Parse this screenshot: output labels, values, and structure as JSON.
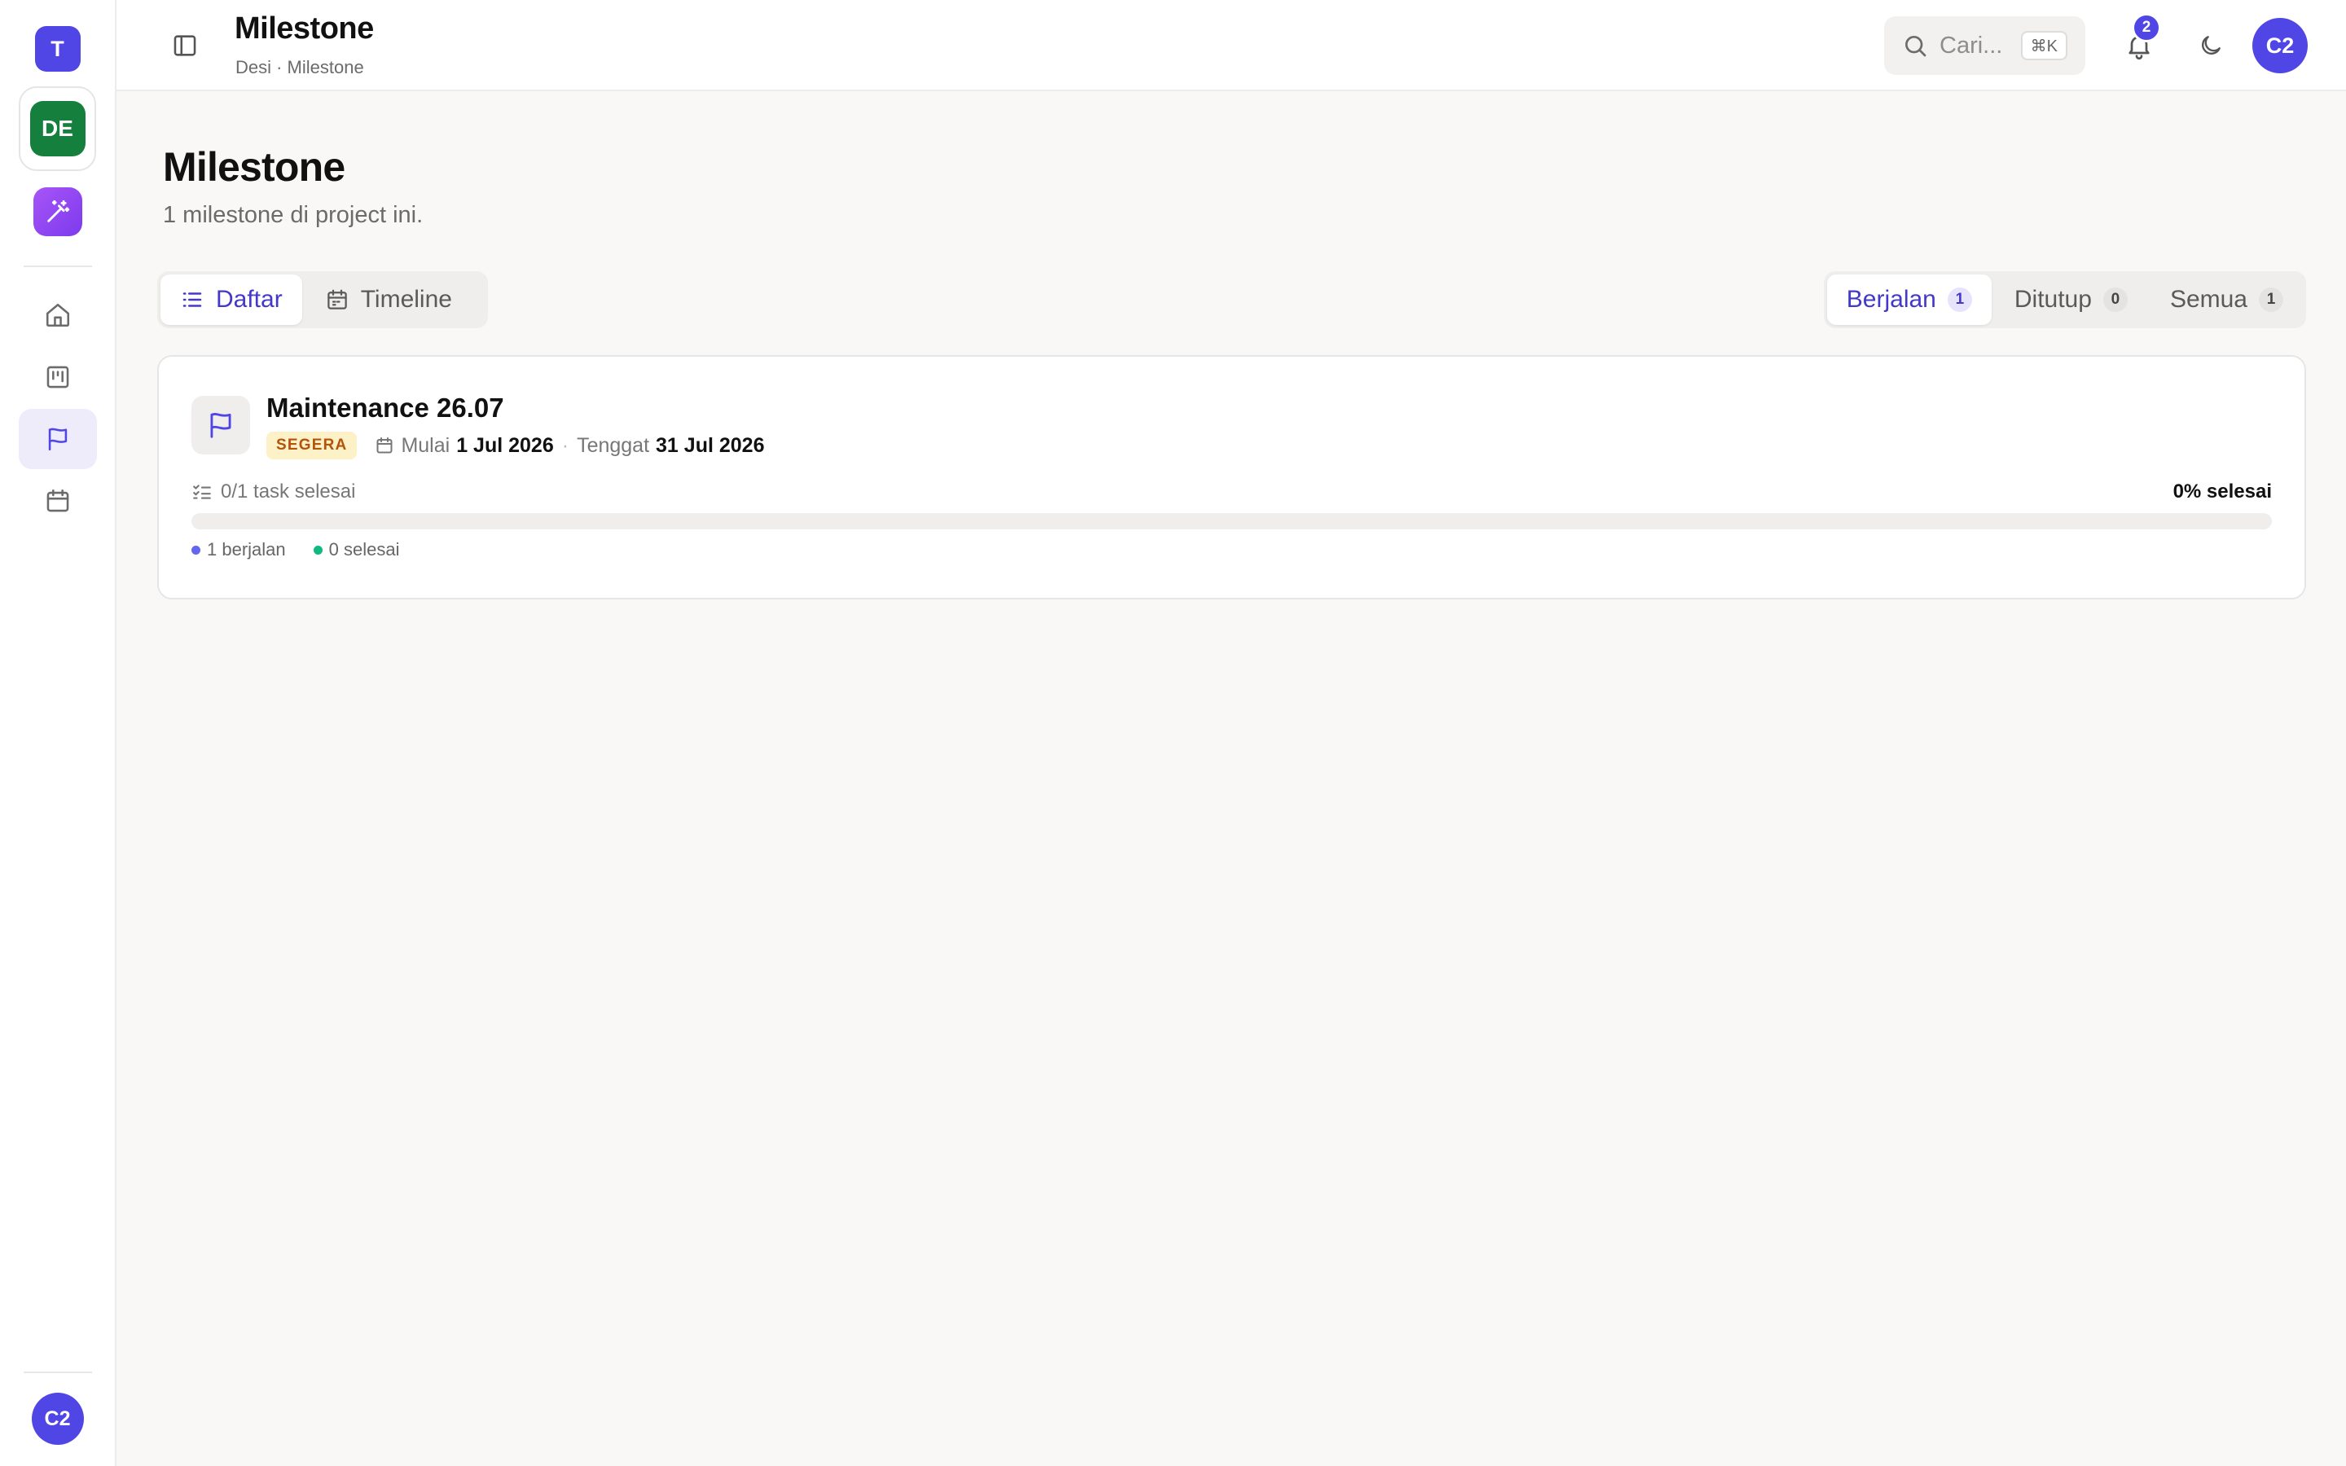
{
  "rail": {
    "workspace_initial": "T",
    "project_initials": "DE",
    "user_initials": "C2",
    "items": [
      {
        "name": "home",
        "icon": "home-icon",
        "active": false
      },
      {
        "name": "board",
        "icon": "board-icon",
        "active": false
      },
      {
        "name": "milestone",
        "icon": "flag-icon",
        "active": true
      },
      {
        "name": "calendar",
        "icon": "calendar-icon",
        "active": false
      }
    ]
  },
  "topbar": {
    "title": "Milestone",
    "breadcrumb": "Desi · Milestone",
    "search_placeholder": "Cari...",
    "search_shortcut": "⌘K",
    "notification_count": "2",
    "user_initials": "C2"
  },
  "page": {
    "heading": "Milestone",
    "subtitle": "1 milestone di project ini."
  },
  "view_toggle": {
    "list_label": "Daftar",
    "timeline_label": "Timeline",
    "selected": "list"
  },
  "filter": {
    "tabs": [
      {
        "label": "Berjalan",
        "count": "1",
        "active": true
      },
      {
        "label": "Ditutup",
        "count": "0",
        "active": false
      },
      {
        "label": "Semua",
        "count": "1",
        "active": false
      }
    ]
  },
  "milestones": [
    {
      "name": "Maintenance 26.07",
      "badge": "SEGERA",
      "start_label": "Mulai",
      "start_date": "1 Jul 2026",
      "due_label": "Tenggat",
      "due_date": "31 Jul 2026",
      "tasks_text": "0/1 task selesai",
      "percent_text": "0% selesai",
      "progress": 0,
      "running_text": "1 berjalan",
      "done_text": "0 selesai"
    }
  ],
  "colors": {
    "accent": "#4f46e5",
    "project": "#15803d",
    "badge_bg": "#fdf1c7",
    "badge_fg": "#b45309",
    "running_dot": "#6366f1",
    "done_dot": "#10b981"
  }
}
